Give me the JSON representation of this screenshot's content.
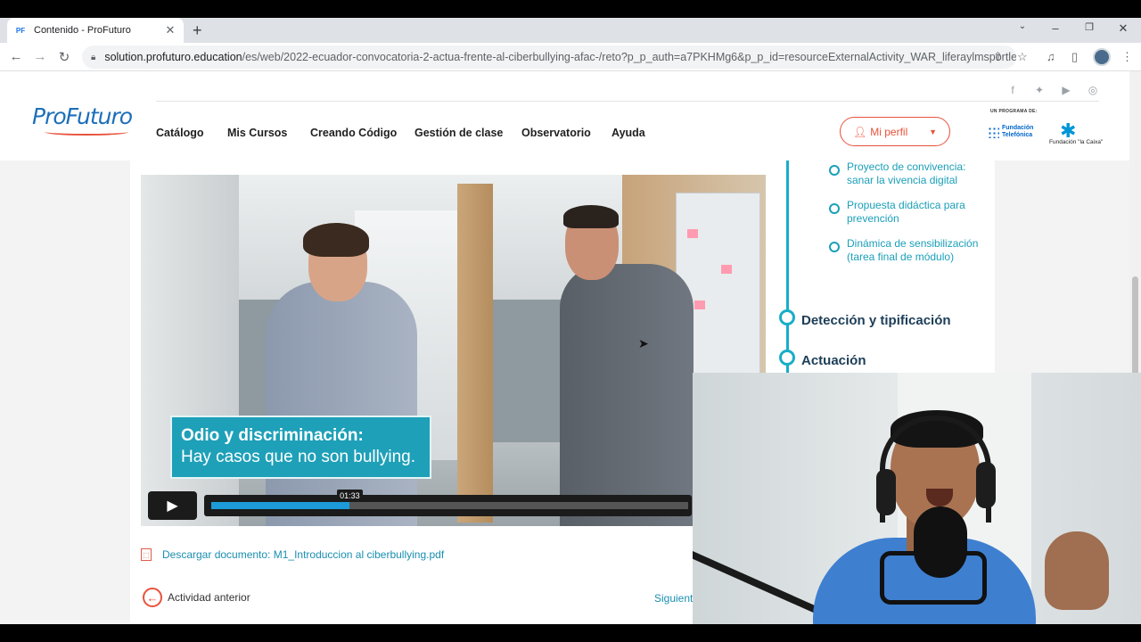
{
  "browser": {
    "tab_title": "Contenido - ProFuturo",
    "favicon_text": "PF",
    "url_host": "solution.profuturo.education",
    "url_path": "/es/web/2022-ecuador-convocatoria-2-actua-frente-al-ciberbullying-afac-/reto?p_p_auth=a7PKHMg6&p_p_id=resourceExternalActivity_WAR_liferaylmsportlet&p..."
  },
  "header": {
    "logo": "ProFuturo",
    "nav": [
      "Catálogo",
      "Mis Cursos",
      "Creando Código",
      "Gestión de clase",
      "Observatorio",
      "Ayuda"
    ],
    "profile_label": "Mi perfil",
    "programa_label": "UN PROGRAMA DE:",
    "fundacion_telefonica": [
      "Fundación",
      "Telefónica"
    ],
    "la_caixa_label": "Fundación \"la Caixa\""
  },
  "video": {
    "caption_title": "Odio y discriminación:",
    "caption_subtitle": "Hay casos que no son bullying.",
    "current_time": "01:33",
    "progress_fraction": 0.29
  },
  "content": {
    "download_label": "Descargar documento: M1_Introduccion al ciberbullying.pdf",
    "prev_activity": "Actividad anterior",
    "next_activity": "Siguiente"
  },
  "sidebar": {
    "sub_items": [
      "Proyecto de convivencia: sanar la vivencia digital",
      "Propuesta didáctica para prevención",
      "Dinámica de sensibilización (tarea final de módulo)"
    ],
    "sections": [
      "Detección y tipificación",
      "Actuación"
    ]
  },
  "colors": {
    "brand_blue": "#1d6fb8",
    "accent_orange": "#e8523c",
    "teal": "#17aec9",
    "link": "#1a8fb0"
  }
}
